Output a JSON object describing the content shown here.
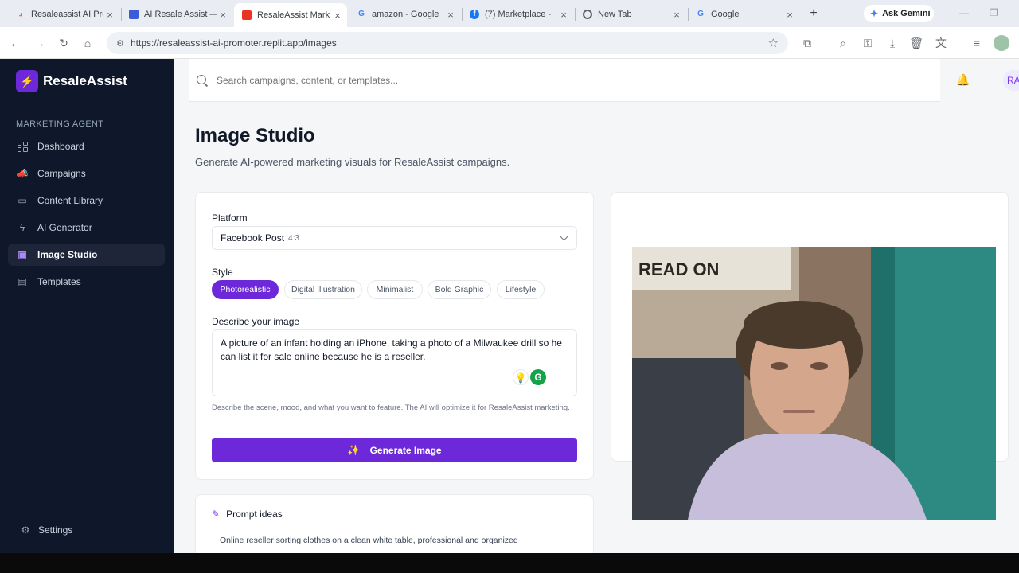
{
  "browser": {
    "tabs": [
      {
        "title": "Resaleassist AI Pro",
        "favicon": "replit-icon",
        "color": "#f26207"
      },
      {
        "title": "AI Resale Assist —",
        "favicon": "web-icon",
        "color": "#3b5bdb"
      },
      {
        "title": "ResaleAssist Mark",
        "favicon": "app-icon",
        "color": "#ea3323",
        "active": true
      },
      {
        "title": "amazon - Google",
        "favicon": "google-icon",
        "color": "#4285f4"
      },
      {
        "title": "(7) Marketplace -",
        "favicon": "facebook-icon",
        "color": "#1877f2"
      },
      {
        "title": "New Tab",
        "favicon": "chrome-icon",
        "color": "#5f6368"
      },
      {
        "title": "Google",
        "favicon": "google-icon",
        "color": "#4285f4"
      }
    ],
    "gemini_label": "Ask Gemini",
    "url": "https://resaleassist-ai-promoter.replit.app/images"
  },
  "sidebar": {
    "brand": "ResaleAssist",
    "section_label": "MARKETING AGENT",
    "items": [
      {
        "label": "Dashboard",
        "icon": "grid-icon"
      },
      {
        "label": "Campaigns",
        "icon": "megaphone-icon"
      },
      {
        "label": "Content Library",
        "icon": "book-icon"
      },
      {
        "label": "AI Generator",
        "icon": "bolt-icon"
      },
      {
        "label": "Image Studio",
        "icon": "image-icon",
        "active": true
      },
      {
        "label": "Templates",
        "icon": "layout-icon"
      }
    ],
    "settings_label": "Settings"
  },
  "header": {
    "search_placeholder": "Search campaigns, content, or templates...",
    "avatar_initials": "RA"
  },
  "page": {
    "title": "Image Studio",
    "subtitle": "Generate AI-powered marketing visuals for ResaleAssist campaigns."
  },
  "form": {
    "platform_label": "Platform",
    "platform_value": "Facebook Post",
    "platform_ratio": "4:3",
    "style_label": "Style",
    "styles": [
      "Photorealistic",
      "Digital Illustration",
      "Minimalist",
      "Bold Graphic",
      "Lifestyle"
    ],
    "selected_style": "Photorealistic",
    "describe_label": "Describe your image",
    "description": "A picture of an infant holding an iPhone, taking a photo of a Milwaukee drill so he can list it for sale online because he is a reseller.",
    "helper": "Describe the scene, mood, and what you want to feature. The AI will optimize it for ResaleAssist marketing.",
    "generate_label": "Generate Image"
  },
  "prompt_ideas": {
    "title": "Prompt ideas",
    "items": [
      "Online reseller sorting clothes on a clean white table, professional and organized"
    ]
  },
  "webcam": {
    "shirt_text": "READ ON"
  },
  "colors": {
    "accent": "#6d28d9",
    "sidebar_bg": "#0f172a"
  }
}
